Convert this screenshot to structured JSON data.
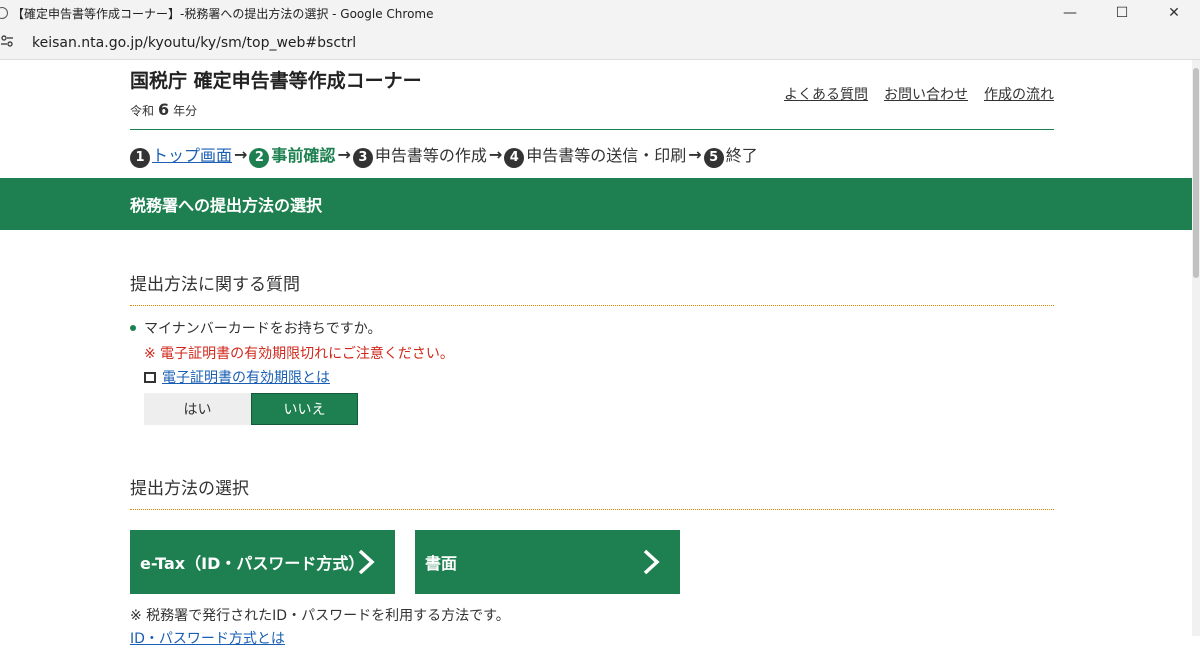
{
  "window": {
    "title": "【確定申告書等作成コーナー】-税務署への提出方法の選択 - Google Chrome",
    "minimize_glyph": "—",
    "maximize_glyph": "☐",
    "close_glyph": "✕"
  },
  "address": {
    "url": "keisan.nta.go.jp/kyoutu/ky/sm/top_web#bsctrl"
  },
  "header": {
    "title": "国税庁 確定申告書等作成コーナー",
    "era": "令和",
    "year_num": "6",
    "year_suffix": "年分",
    "links": [
      "よくある質問",
      "お問い合わせ",
      "作成の流れ"
    ]
  },
  "steps": [
    {
      "num": "1",
      "label": "トップ画面"
    },
    {
      "num": "2",
      "label": "事前確認"
    },
    {
      "num": "3",
      "label": "申告書等の作成"
    },
    {
      "num": "4",
      "label": "申告書等の送信・印刷"
    },
    {
      "num": "5",
      "label": "終了"
    }
  ],
  "arrow": "→",
  "banner": {
    "title": "税務署への提出方法の選択"
  },
  "question_section": {
    "heading": "提出方法に関する質問",
    "question": "マイナンバーカードをお持ちですか。",
    "warning": "※ 電子証明書の有効期限切れにご注意ください。",
    "link": "電子証明書の有効期限とは",
    "yes": "はい",
    "no": "いいえ"
  },
  "method_section": {
    "heading": "提出方法の選択",
    "etax_button": "e-Tax（ID・パスワード方式）",
    "paper_button": "書面",
    "note": "※ 税務署で発行されたID・パスワードを利用する方法です。",
    "cut_link": "ID・パスワード方式とは"
  },
  "colors": {
    "accent": "#1e8050",
    "warning": "#d0281c",
    "link": "#1a5fb4"
  }
}
